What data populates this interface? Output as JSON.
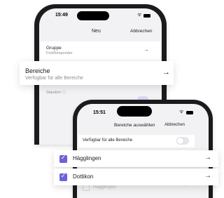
{
  "screen1": {
    "status_time": "15:49",
    "nav_title": "Neu",
    "nav_cancel": "Abbrechen",
    "gruppe": {
      "label": "Gruppe",
      "value": "FirstResponder"
    },
    "bereiche": {
      "title": "Bereiche",
      "subtitle": "Verfügbar für alle Bereiche"
    },
    "standort_label": "Standort ⓘ"
  },
  "screen2": {
    "status_time": "15:51",
    "nav_title": "Bereiche auswählen",
    "nav_cancel": "Abbrechen",
    "all_areas_label": "Verfügbar für alle Bereiche",
    "all_areas_enabled": false,
    "regions": [
      {
        "label": "Hägglingen",
        "checked": true
      },
      {
        "label": "Dottikon",
        "checked": true
      }
    ],
    "background_item": "Hägglingen"
  },
  "icons": {
    "arrow": "→",
    "check": "✓",
    "wifi": "ᯤ"
  },
  "colors": {
    "accent": "#6a62d6",
    "background": "#f2f2f4",
    "secondary_text": "#8e8e93"
  }
}
